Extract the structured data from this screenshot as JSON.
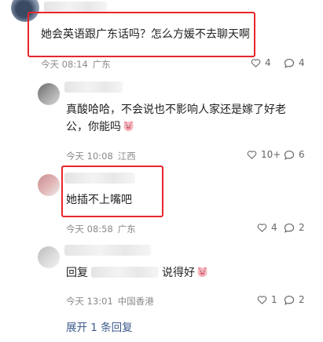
{
  "comments": [
    {
      "text": "她会英语跟广东话吗？怎么方媛不去聊天啊",
      "time": "今天 08:14",
      "location": "广东",
      "likes": "4",
      "replies": "4"
    },
    {
      "text_line1": "真酸哈哈，不会说也不影响人家还是嫁了好老",
      "text_line2": "公，你能吗",
      "time": "今天 10:08",
      "location": "江西",
      "likes": "10+",
      "replies": "6"
    },
    {
      "text": "她插不上嘴吧",
      "time": "今天 08:58",
      "location": "广东",
      "likes": "4",
      "replies": "2"
    },
    {
      "reply_prefix": "回复",
      "reply_suffix": "说得好",
      "time": "今天 13:01",
      "location": "中国香港",
      "likes": "1",
      "replies": "2"
    }
  ],
  "expand_label": "展开 1 条回复",
  "colors": {
    "highlight": "#e8262b",
    "link": "#3d5b8c",
    "meta": "#8a8a8a"
  }
}
